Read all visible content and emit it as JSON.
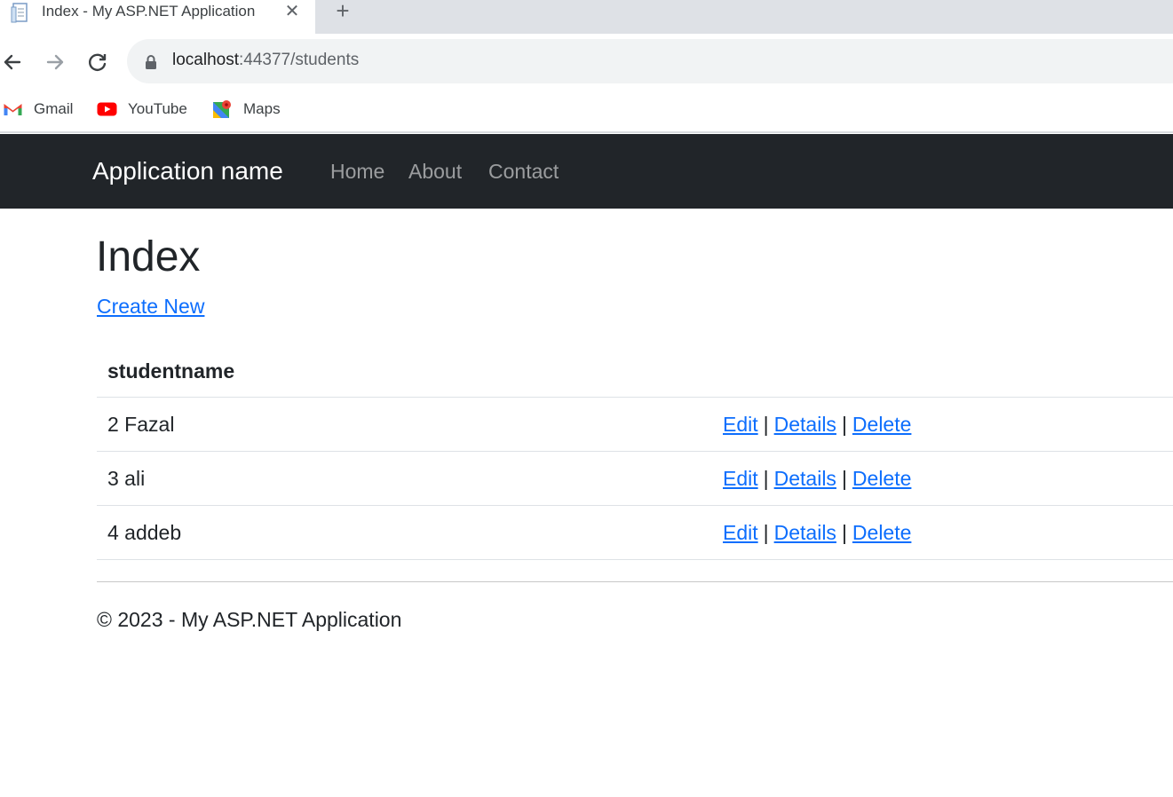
{
  "browser": {
    "tab": {
      "title": "Index - My ASP.NET Application",
      "close_icon": "close-icon"
    },
    "new_tab_icon": "plus-icon",
    "address_bar": {
      "host": "localhost",
      "rest": ":44377/students"
    },
    "bookmarks": [
      {
        "label": "Gmail",
        "icon": "gmail-icon"
      },
      {
        "label": "YouTube",
        "icon": "youtube-icon"
      },
      {
        "label": "Maps",
        "icon": "maps-icon"
      }
    ]
  },
  "navbar": {
    "brand": "Application name",
    "links": [
      {
        "label": "Home"
      },
      {
        "label": "About"
      },
      {
        "label": "Contact"
      }
    ]
  },
  "main": {
    "title": "Index",
    "create_link": "Create New",
    "table": {
      "header": "studentname",
      "rows": [
        {
          "name": "2 Fazal"
        },
        {
          "name": "3 ali"
        },
        {
          "name": "4 addeb"
        }
      ],
      "actions": {
        "edit": "Edit",
        "details": "Details",
        "delete": "Delete",
        "separator": "|"
      }
    }
  },
  "footer": {
    "text": "© 2023 - My ASP.NET Application"
  },
  "colors": {
    "navbar_bg": "#212529",
    "link": "#0d6efd",
    "text": "#212529"
  }
}
